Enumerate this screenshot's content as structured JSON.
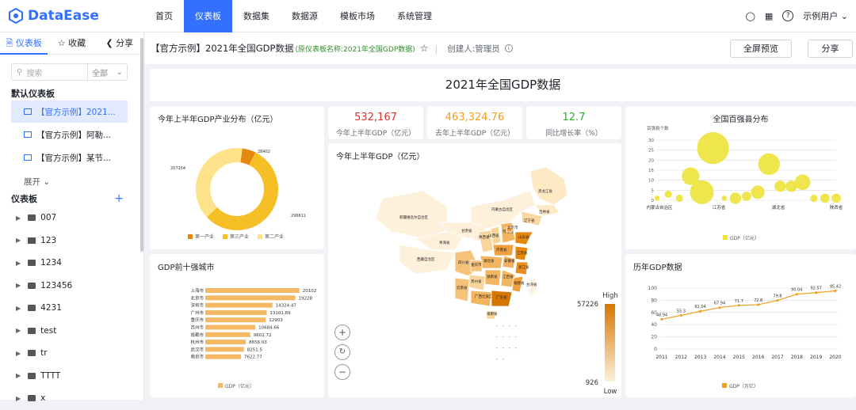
{
  "nav": {
    "brand": "DataEase",
    "items": [
      "首页",
      "仪表板",
      "数据集",
      "数据源",
      "模板市场",
      "系统管理"
    ],
    "user": "示例用户"
  },
  "sidebar": {
    "tabs": [
      "仪表板",
      "收藏",
      "分享"
    ],
    "search_placeholder": "搜索",
    "search_scope": "全部",
    "default_header": "默认仪表板",
    "defaults": [
      "【官方示例】2021...",
      "【官方示例】阿勒...",
      "【官方示例】某节..."
    ],
    "expand": "展开",
    "section": "仪表板",
    "folders": [
      "007",
      "123",
      "1234",
      "123456",
      "4231",
      "test",
      "tr",
      "TTTT",
      "x"
    ]
  },
  "header": {
    "title": "【官方示例】2021年全国GDP数据",
    "original": "(原仪表板名称:2021年全国GDP数据)",
    "creator": "创建人:管理员",
    "more": "···",
    "preview_btn": "全屏预览",
    "share_btn": "分享"
  },
  "banner": "2021年全国GDP数据",
  "kpis": [
    {
      "value": "532,167",
      "label": "今年上半年GDP（亿元）",
      "color": "#e03030"
    },
    {
      "value": "463,324.76",
      "label": "去年上半年GDP（亿元）",
      "color": "#f0a020"
    },
    {
      "value": "12.7",
      "label": "同比增长率（%）",
      "color": "#2ab02a"
    }
  ],
  "colors": {
    "accent": "#3370ff",
    "c1": "#e6870e",
    "c2": "#f5bf25",
    "c3": "#fde28a",
    "bar": "#f5b865",
    "bubble": "#ede33a",
    "line": "#f0a020"
  },
  "chart_data": [
    {
      "type": "pie",
      "title": "今年上半年GDP产业分布（亿元）",
      "categories": [
        "第一产业",
        "第三产业",
        "第二产业"
      ],
      "values": [
        28402,
        296611,
        207154
      ],
      "labels": [
        "28402",
        "296611",
        "207154"
      ]
    },
    {
      "type": "bar",
      "title": "GDP前十强城市",
      "categories": [
        "上海市",
        "北京市",
        "深圳市",
        "广州市",
        "重庆市",
        "苏州市",
        "成都市",
        "杭州市",
        "武汉市",
        "南京市"
      ],
      "values": [
        20102,
        19228,
        14324.47,
        13101.89,
        12903,
        10684.66,
        9602.72,
        8656.03,
        8251.5,
        7622.77
      ],
      "labels": [
        "20102",
        "19228",
        "14324.47",
        "13101.89",
        "12903",
        "10684.66",
        "9602.72",
        "8656.03",
        "8251.5",
        "7622.77"
      ],
      "legend": "GDP（亿元）"
    },
    {
      "type": "map",
      "title": "今年上半年GDP（亿元）",
      "visual_max": "57226",
      "visual_min": "926",
      "high": "High",
      "low": "Low",
      "region_labels": [
        "黑龙江省",
        "吉林省",
        "辽宁省",
        "内蒙古自治区",
        "新疆维吾尔自治区",
        "甘肃省",
        "青海省",
        "西藏自治区",
        "四川省",
        "陕西省",
        "山西省",
        "河北省",
        "北京市",
        "山东省",
        "河南省",
        "江苏省",
        "安徽省",
        "湖北省",
        "重庆市",
        "浙江省",
        "湖南省",
        "江西省",
        "福建省",
        "贵州省",
        "云南省",
        "广西壮族自治区",
        "广东省",
        "台湾省",
        "海南省"
      ]
    },
    {
      "type": "scatter",
      "title": "全国百强县分布",
      "ylabel": "百强县个数",
      "yticks": [
        "30",
        "25",
        "20",
        "15",
        "10",
        "5",
        "0"
      ],
      "xticks": [
        "内蒙古自治区",
        "江苏省",
        "湖北省",
        "陕西省"
      ],
      "ylim": [
        0,
        30
      ],
      "points": [
        {
          "x": 0,
          "y": 1,
          "s": 1
        },
        {
          "x": 1,
          "y": 3,
          "s": 2
        },
        {
          "x": 2,
          "y": 1,
          "s": 2
        },
        {
          "x": 3,
          "y": 12,
          "s": 7
        },
        {
          "x": 4,
          "y": 4,
          "s": 10
        },
        {
          "x": 5,
          "y": 26,
          "s": 14
        },
        {
          "x": 6,
          "y": 1,
          "s": 1
        },
        {
          "x": 7,
          "y": 1,
          "s": 4
        },
        {
          "x": 8,
          "y": 2,
          "s": 3
        },
        {
          "x": 9,
          "y": 4,
          "s": 5
        },
        {
          "x": 10,
          "y": 18,
          "s": 9
        },
        {
          "x": 11,
          "y": 7,
          "s": 4
        },
        {
          "x": 12,
          "y": 7,
          "s": 4
        },
        {
          "x": 13,
          "y": 9,
          "s": 6
        },
        {
          "x": 14,
          "y": 1,
          "s": 2
        },
        {
          "x": 15,
          "y": 1,
          "s": 3
        },
        {
          "x": 16,
          "y": 1,
          "s": 3
        }
      ],
      "legend": "GDP（亿元）"
    },
    {
      "type": "line",
      "title": "历年GDP数据",
      "categories": [
        "2011",
        "2012",
        "2013",
        "2014",
        "2015",
        "2016",
        "2017",
        "2018",
        "2019",
        "2020"
      ],
      "values": [
        48.94,
        55.3,
        62.04,
        67.94,
        71.7,
        72.8,
        79.8,
        90.04,
        92.57,
        95.42
      ],
      "labels": [
        "48.94",
        "55.3",
        "62.04",
        "67.94",
        "71.7",
        "72.8",
        "79.8",
        "90.04",
        "92.57",
        "95.42"
      ],
      "yticks": [
        "100",
        "80",
        "60",
        "40",
        "20",
        "0"
      ],
      "ylim": [
        0,
        100
      ],
      "legend": "GDP（万亿）"
    }
  ]
}
